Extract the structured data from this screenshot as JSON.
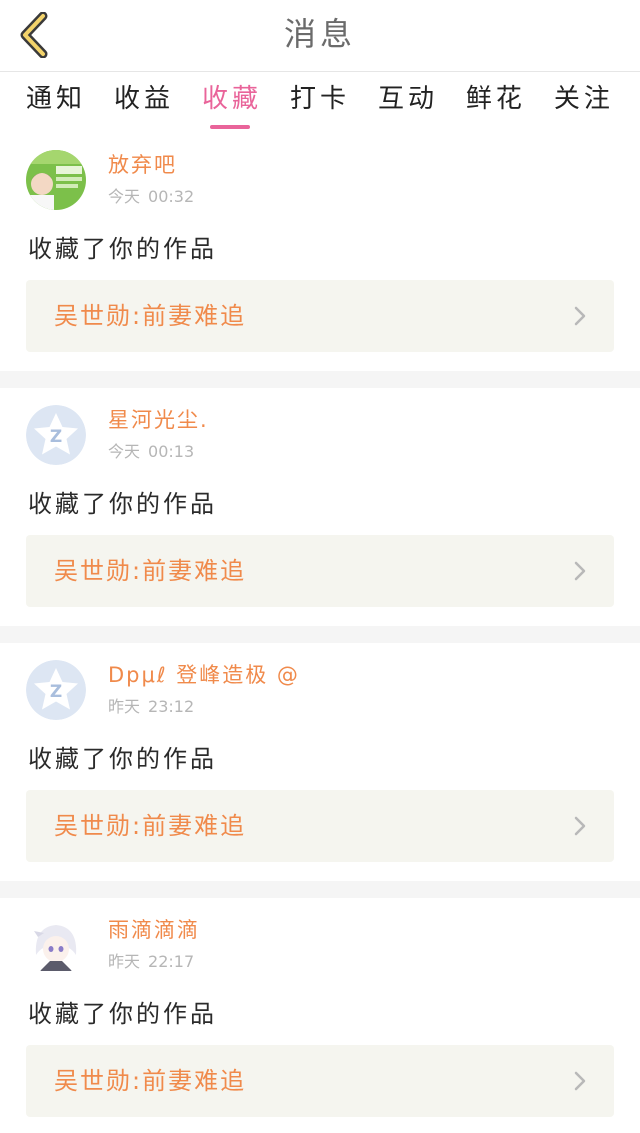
{
  "header": {
    "title": "消息",
    "back_icon": "chevron-left-icon"
  },
  "tabs": [
    {
      "label": "通知",
      "active": false
    },
    {
      "label": "收益",
      "active": false
    },
    {
      "label": "收藏",
      "active": true
    },
    {
      "label": "打卡",
      "active": false
    },
    {
      "label": "互动",
      "active": false
    },
    {
      "label": "鲜花",
      "active": false
    },
    {
      "label": "关注",
      "active": false
    }
  ],
  "colors": {
    "accent": "#e9649a",
    "name": "#f08a4b",
    "work_bg": "#f5f5ef"
  },
  "messages": [
    {
      "user": "放弃吧",
      "day": "今天",
      "time": "00:32",
      "action": "收藏了你的作品",
      "work": "吴世勋:前妻难追",
      "avatar": "photo-avatar"
    },
    {
      "user": "星河光尘.",
      "day": "今天",
      "time": "00:13",
      "action": "收藏了你的作品",
      "work": "吴世勋:前妻难追",
      "avatar": "qq-default-avatar"
    },
    {
      "user": "Dpμℓ 登峰造极 @",
      "day": "昨天",
      "time": "23:12",
      "action": "收藏了你的作品",
      "work": "吴世勋:前妻难追",
      "avatar": "qq-default-avatar"
    },
    {
      "user": "雨滴滴滴",
      "day": "昨天",
      "time": "22:17",
      "action": "收藏了你的作品",
      "work": "吴世勋:前妻难追",
      "avatar": "anime-avatar"
    }
  ]
}
